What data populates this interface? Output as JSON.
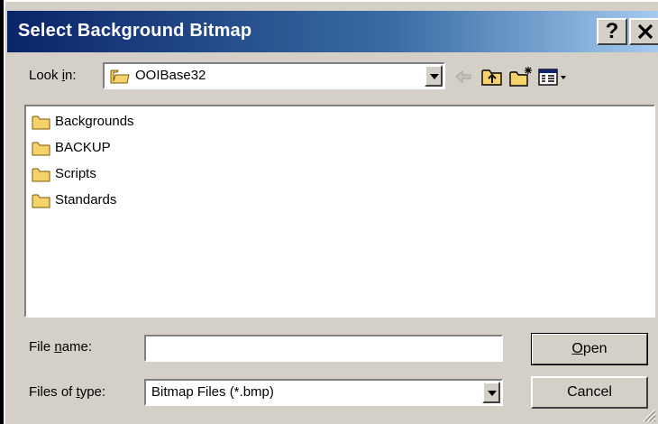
{
  "dialog": {
    "title": "Select Background Bitmap",
    "help_label": "?",
    "close_label": "✕"
  },
  "lookin": {
    "label_prefix": "Look ",
    "label_mnemonic": "i",
    "label_suffix": "n:",
    "value": "OOIBase32"
  },
  "toolbar": {
    "icons": [
      "back-arrow-icon",
      "up-folder-icon",
      "new-folder-icon",
      "view-menu-icon"
    ]
  },
  "files": {
    "items": [
      "Backgrounds",
      "BACKUP",
      "Scripts",
      "Standards"
    ]
  },
  "filename": {
    "label_prefix": "File ",
    "label_mnemonic": "n",
    "label_suffix": "ame:",
    "value": ""
  },
  "filetype": {
    "label_prefix": "Files of ",
    "label_mnemonic": "t",
    "label_suffix": "ype:",
    "value": "Bitmap Files (*.bmp)"
  },
  "buttons": {
    "open_mnemonic": "O",
    "open_rest": "pen",
    "cancel": "Cancel"
  },
  "colors": {
    "title_gradient_start": "#0a246a",
    "title_gradient_end": "#a6caf0",
    "face": "#d4d0c8",
    "folder": "#f5d36a"
  }
}
